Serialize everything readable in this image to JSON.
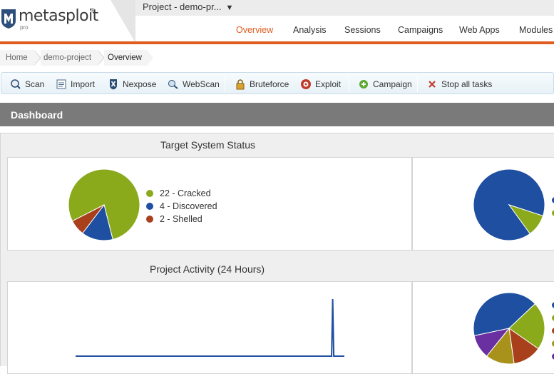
{
  "header": {
    "logo_text": "metasploit",
    "logo_reg": "®",
    "logo_sub": "pro",
    "project_selector": "Project - demo-pr...",
    "caret": "▼"
  },
  "nav": {
    "items": [
      "Overview",
      "Analysis",
      "Sessions",
      "Campaigns",
      "Web Apps",
      "Modules"
    ],
    "active": "Overview"
  },
  "breadcrumb": [
    "Home",
    "demo-project",
    "Overview"
  ],
  "toolbar": {
    "scan": "Scan",
    "import": "Import",
    "nexpose": "Nexpose",
    "webscan": "WebScan",
    "bruteforce": "Bruteforce",
    "exploit": "Exploit",
    "campaign": "Campaign",
    "stop": "Stop all tasks"
  },
  "dashboard": {
    "title": "Dashboard",
    "target_status_title": "Target System Status",
    "activity_title": "Project Activity (24 Hours)",
    "target_legend": [
      "22 - Cracked",
      "4 - Discovered",
      "2 - Shelled"
    ]
  },
  "colors": {
    "accent": "#e15c1f",
    "green": "#8aaa1c",
    "blue": "#1e4fa0",
    "red": "#a8401c",
    "olive": "#a8921c",
    "purple": "#6a2fa0"
  },
  "chart_data": [
    {
      "type": "pie",
      "categories": [
        "Cracked",
        "Discovered",
        "Shelled"
      ],
      "values": [
        22,
        4,
        2
      ],
      "colors": [
        "#8aaa1c",
        "#1e4fa0",
        "#a8401c"
      ]
    },
    {
      "type": "pie",
      "values": [
        90,
        10
      ],
      "colors": [
        "#1e4fa0",
        "#8aaa1c"
      ]
    },
    {
      "type": "line",
      "series": [
        {
          "values": [
            0,
            0,
            0,
            0,
            0,
            0,
            0,
            0,
            0,
            0,
            0,
            0,
            0,
            0,
            0,
            0,
            0,
            0,
            0,
            0,
            0,
            0,
            1,
            0
          ]
        }
      ]
    },
    {
      "type": "pie",
      "values": [
        38,
        20,
        12,
        12,
        10
      ],
      "colors": [
        "#1e4fa0",
        "#8aaa1c",
        "#a8401c",
        "#a8921c",
        "#6a2fa0"
      ]
    }
  ]
}
